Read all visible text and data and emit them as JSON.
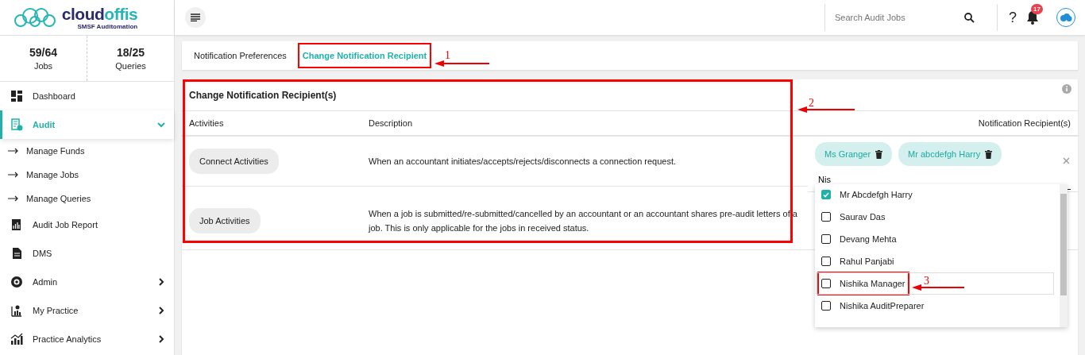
{
  "brand": {
    "name_part1": "cloud",
    "name_part2": "offis",
    "tagline": "SMSF Auditomation"
  },
  "header": {
    "search": {
      "placeholder": "Search Audit Jobs"
    },
    "help": "?",
    "notification_count": "17"
  },
  "stats": [
    {
      "value": "59/64",
      "label": "Jobs"
    },
    {
      "value": "18/25",
      "label": "Queries"
    }
  ],
  "sidebar": {
    "items": [
      {
        "label": "Dashboard",
        "selected": false
      },
      {
        "label": "Audit",
        "selected": true,
        "expanded": true,
        "children": [
          {
            "label": "Manage Funds"
          },
          {
            "label": "Manage Jobs"
          },
          {
            "label": "Manage Queries"
          }
        ]
      },
      {
        "label": "Audit Job Report",
        "selected": false
      },
      {
        "label": "DMS",
        "selected": false
      },
      {
        "label": "Admin",
        "selected": false,
        "expanded": false
      },
      {
        "label": "My Practice",
        "selected": false,
        "expanded": false
      },
      {
        "label": "Practice Analytics",
        "selected": false,
        "expanded": false
      }
    ]
  },
  "tabs": [
    {
      "label": "Notification Preferences",
      "selected": false,
      "highlighted": false
    },
    {
      "label": "Change Notification Recipient",
      "selected": true,
      "highlighted": true
    }
  ],
  "card": {
    "title": "Change Notification Recipient(s)",
    "highlighted": true,
    "columns": [
      "Activities",
      "Description",
      "Notification Recipient(s)"
    ],
    "rows": [
      {
        "activity": "Connect Activities",
        "description": "When an accountant initiates/accepts/rejects/disconnects a connection request.",
        "recipients": [
          {
            "name": "Ms Granger"
          },
          {
            "name": "Mr abcdefgh Harry"
          }
        ],
        "search_value": "Nis",
        "options": [
          {
            "label": "Mr Abcdefgh Harry",
            "checked": true,
            "highlighted": false
          },
          {
            "label": "Saurav Das",
            "checked": false,
            "highlighted": false
          },
          {
            "label": "Devang Mehta",
            "checked": false,
            "highlighted": false
          },
          {
            "label": "Rahul Panjabi",
            "checked": false,
            "highlighted": false
          },
          {
            "label": "Nishika Manager",
            "checked": false,
            "highlighted": true
          },
          {
            "label": "Nishika AuditPreparer",
            "checked": false,
            "highlighted": false
          }
        ]
      },
      {
        "activity": "Job Activities",
        "description": "When a job is submitted/re-submitted/cancelled by an accountant or an accountant shares pre-audit letters of a job. This is only applicable for the jobs in received status."
      }
    ]
  },
  "annotations": [
    {
      "label": "1"
    },
    {
      "label": "2"
    },
    {
      "label": "3"
    }
  ]
}
